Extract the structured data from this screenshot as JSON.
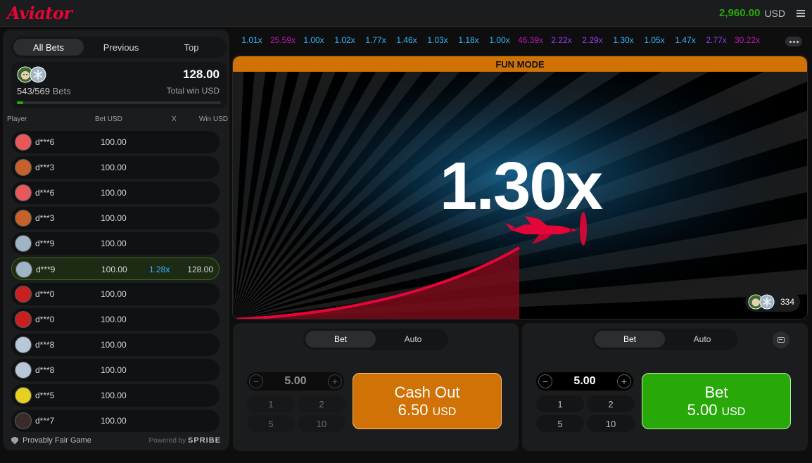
{
  "header": {
    "logo": "Aviator",
    "balance": "2,960.00",
    "currency": "USD"
  },
  "left": {
    "tabs": [
      "All Bets",
      "Previous",
      "Top"
    ],
    "summary": {
      "bets_count": "543/569",
      "bets_label": "Bets",
      "total_win": "128.00",
      "total_win_label": "Total win USD",
      "progress": 0.03
    },
    "columns": [
      "Player",
      "Bet USD",
      "X",
      "Win USD"
    ],
    "players": [
      {
        "name": "d***6",
        "bet": "100.00",
        "x": "",
        "win": "",
        "avatar_color": "#e8585a"
      },
      {
        "name": "d***3",
        "bet": "100.00",
        "x": "",
        "win": "",
        "avatar_color": "#c8602a"
      },
      {
        "name": "d***6",
        "bet": "100.00",
        "x": "",
        "win": "",
        "avatar_color": "#e8585a"
      },
      {
        "name": "d***3",
        "bet": "100.00",
        "x": "",
        "win": "",
        "avatar_color": "#c8602a"
      },
      {
        "name": "d***9",
        "bet": "100.00",
        "x": "",
        "win": "",
        "avatar_color": "#9fb4c4"
      },
      {
        "name": "d***9",
        "bet": "100.00",
        "x": "1.28x",
        "win": "128.00",
        "avatar_color": "#9fb4c4"
      },
      {
        "name": "d***0",
        "bet": "100.00",
        "x": "",
        "win": "",
        "avatar_color": "#c8201e"
      },
      {
        "name": "d***0",
        "bet": "100.00",
        "x": "",
        "win": "",
        "avatar_color": "#c8201e"
      },
      {
        "name": "d***8",
        "bet": "100.00",
        "x": "",
        "win": "",
        "avatar_color": "#b8c8d8"
      },
      {
        "name": "d***8",
        "bet": "100.00",
        "x": "",
        "win": "",
        "avatar_color": "#b8c8d8"
      },
      {
        "name": "d***5",
        "bet": "100.00",
        "x": "",
        "win": "",
        "avatar_color": "#e8d020"
      },
      {
        "name": "d***7",
        "bet": "100.00",
        "x": "",
        "win": "",
        "avatar_color": "#3a2a2a"
      }
    ],
    "footer": {
      "fair": "Provably Fair Game",
      "powered_by": "Powered by",
      "brand": "SPRIBE"
    }
  },
  "history": [
    {
      "v": "1.01x",
      "c": "#34b4ff"
    },
    {
      "v": "25.59x",
      "c": "#c017b4"
    },
    {
      "v": "1.00x",
      "c": "#34b4ff"
    },
    {
      "v": "1.02x",
      "c": "#34b4ff"
    },
    {
      "v": "1.77x",
      "c": "#34b4ff"
    },
    {
      "v": "1.46x",
      "c": "#34b4ff"
    },
    {
      "v": "1.03x",
      "c": "#34b4ff"
    },
    {
      "v": "1.18x",
      "c": "#34b4ff"
    },
    {
      "v": "1.00x",
      "c": "#34b4ff"
    },
    {
      "v": "46.39x",
      "c": "#c017b4"
    },
    {
      "v": "2.22x",
      "c": "#913ef8"
    },
    {
      "v": "2.29x",
      "c": "#913ef8"
    },
    {
      "v": "1.30x",
      "c": "#34b4ff"
    },
    {
      "v": "1.05x",
      "c": "#34b4ff"
    },
    {
      "v": "1.47x",
      "c": "#34b4ff"
    },
    {
      "v": "2.77x",
      "c": "#913ef8"
    },
    {
      "v": "30.22x",
      "c": "#c017b4"
    }
  ],
  "game": {
    "mode_label": "FUN MODE",
    "multiplier": "1.30x",
    "online_count": "334"
  },
  "panel1": {
    "tabs": [
      "Bet",
      "Auto"
    ],
    "stake": "5.00",
    "quick": [
      "1",
      "2",
      "5",
      "10"
    ],
    "button_line1": "Cash Out",
    "button_amount": "6.50",
    "button_currency": "USD"
  },
  "panel2": {
    "tabs": [
      "Bet",
      "Auto"
    ],
    "stake": "5.00",
    "quick": [
      "1",
      "2",
      "5",
      "10"
    ],
    "button_line1": "Bet",
    "button_amount": "5.00",
    "button_currency": "USD"
  },
  "colors": {
    "accent_red": "#e50539",
    "win_green": "#28a909",
    "cashout_orange": "#d07206"
  }
}
